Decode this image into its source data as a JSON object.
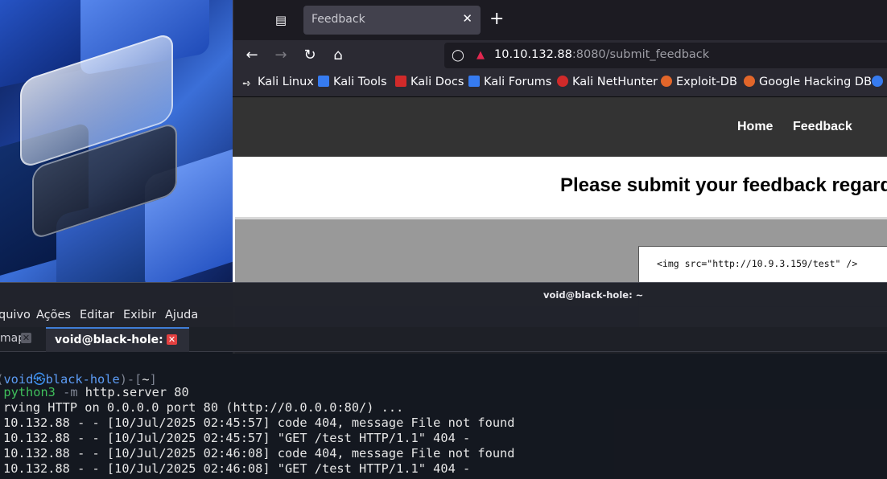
{
  "browser": {
    "tab": {
      "title": "Feedback"
    },
    "url": {
      "host": "10.10.132.88",
      "rest": ":8080/submit_feedback"
    },
    "bookmarks": [
      {
        "label": "Kali Linux",
        "icon": "kali-linux-icon",
        "color": "#2a2a2a"
      },
      {
        "label": "Kali Tools",
        "icon": "kali-tools-icon",
        "color": "#367bf0"
      },
      {
        "label": "Kali Docs",
        "icon": "kali-docs-icon",
        "color": "#d12a2a"
      },
      {
        "label": "Kali Forums",
        "icon": "kali-forums-icon",
        "color": "#367bf0"
      },
      {
        "label": "Kali NetHunter",
        "icon": "kali-nethunter-icon",
        "color": "#d12a2a"
      },
      {
        "label": "Exploit-DB",
        "icon": "exploit-db-icon",
        "color": "#e2662a"
      },
      {
        "label": "Google Hacking DB",
        "icon": "ghdb-icon",
        "color": "#e2662a"
      }
    ],
    "site": {
      "nav": [
        "Home",
        "Feedback"
      ],
      "heading": "Please submit your feedback regard",
      "feedback_text": "<img src=\"http://10.9.3.159/test\" />"
    }
  },
  "terminal": {
    "title": "void@black-hole: ~",
    "menu": [
      "quivo",
      "Ações",
      "Editar",
      "Exibir",
      "Ajuda"
    ],
    "tabs": [
      {
        "label": "map",
        "active": false
      },
      {
        "label": "void@black-hole: ~",
        "active": true
      }
    ],
    "prompt": {
      "user": "void",
      "host": "black-hole",
      "dir": "~"
    },
    "command": {
      "cmd": "python3",
      "args": "-m",
      "rest": "http.server 80"
    },
    "lines": [
      "rving HTTP on 0.0.0.0 port 80 (http://0.0.0.0:80/) ...",
      "10.132.88 - - [10/Jul/2025 02:45:57] code 404, message File not found",
      "10.132.88 - - [10/Jul/2025 02:45:57] \"GET /test HTTP/1.1\" 404 -",
      "10.132.88 - - [10/Jul/2025 02:46:08] code 404, message File not found",
      "10.132.88 - - [10/Jul/2025 02:46:08] \"GET /test HTTP/1.1\" 404 -"
    ]
  }
}
